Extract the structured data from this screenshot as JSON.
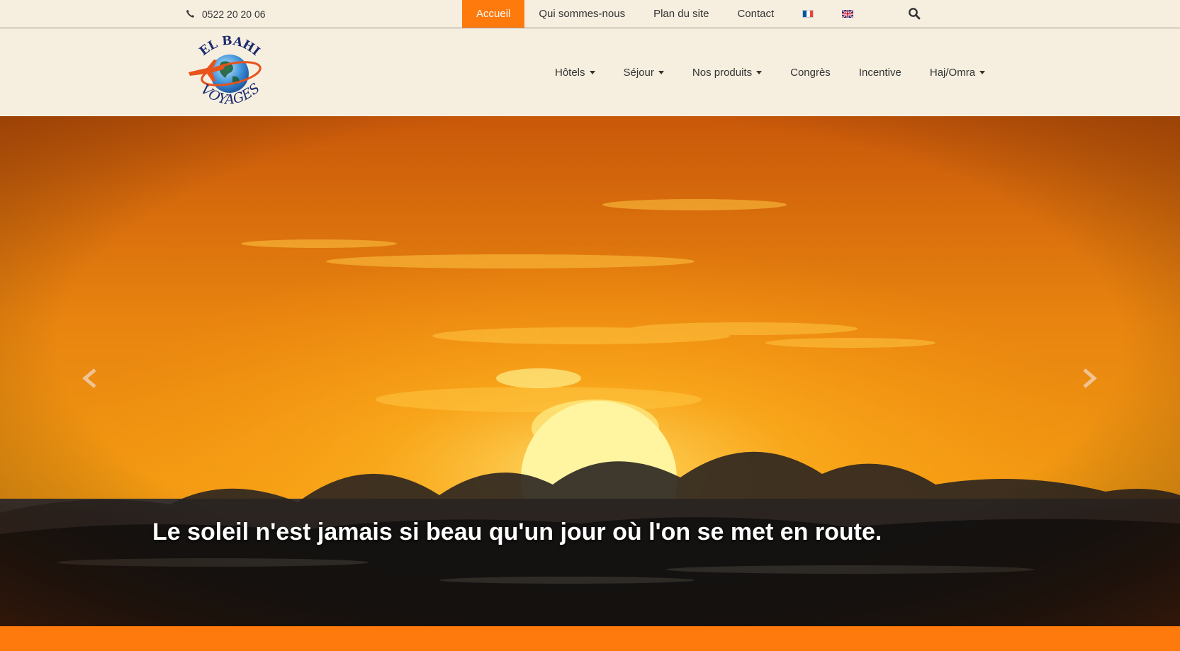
{
  "topbar": {
    "phone": "0522 20 20 06",
    "nav": [
      {
        "label": "Accueil",
        "active": true
      },
      {
        "label": "Qui sommes-nous",
        "active": false
      },
      {
        "label": "Plan du site",
        "active": false
      },
      {
        "label": "Contact",
        "active": false
      }
    ],
    "languages": [
      "fr-flag",
      "uk-flag"
    ]
  },
  "header": {
    "logo": {
      "line1": "EL BAHI",
      "line2": "VOYAGES"
    },
    "menu": [
      {
        "label": "Hôtels",
        "dropdown": true
      },
      {
        "label": "Séjour",
        "dropdown": true
      },
      {
        "label": "Nos produits",
        "dropdown": true
      },
      {
        "label": "Congrès",
        "dropdown": false
      },
      {
        "label": "Incentive",
        "dropdown": false
      },
      {
        "label": "Haj/Omra",
        "dropdown": true
      }
    ]
  },
  "hero": {
    "caption": "Le soleil n'est jamais si beau qu'un jour où l'on se met en route."
  },
  "colors": {
    "accent": "#ff7a0d",
    "background": "#f6efe0",
    "text": "#333333"
  },
  "icons": [
    "phone-icon",
    "search-icon",
    "chevron-left-icon",
    "chevron-right-icon"
  ]
}
